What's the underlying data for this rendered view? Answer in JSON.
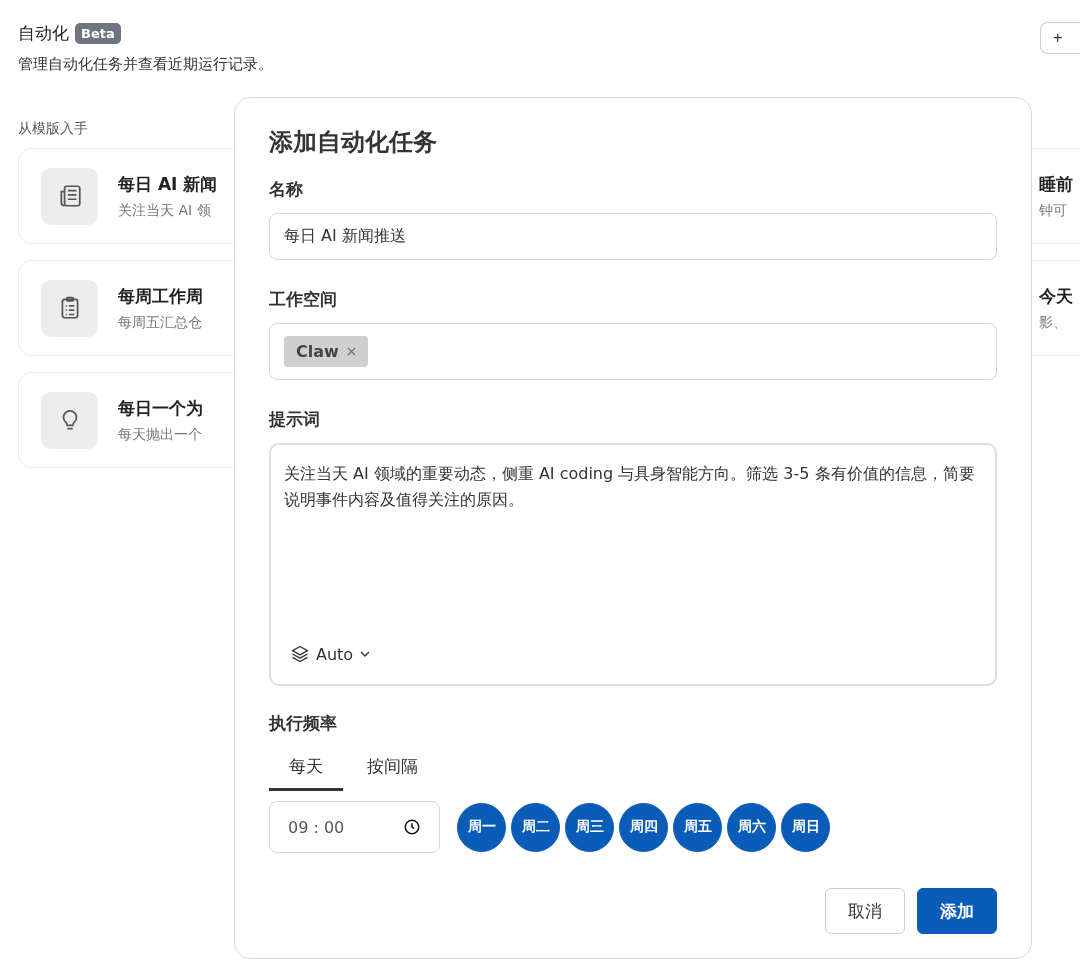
{
  "page": {
    "title": "自动化",
    "badge": "Beta",
    "subtitle": "管理自动化任务并查看近期运行记录。",
    "add_button": "+"
  },
  "templates": {
    "heading": "从模版入手",
    "left": [
      {
        "title": "每日 AI 新闻",
        "desc": "关注当天 AI 领"
      },
      {
        "title": "每周工作周",
        "desc": "每周五汇总仓"
      },
      {
        "title": "每日一个为",
        "desc": "每天抛出一个"
      }
    ],
    "right": [
      {
        "title": "睡前",
        "desc": "钟可"
      },
      {
        "title": "今天",
        "desc": "影、"
      }
    ]
  },
  "dialog": {
    "title": "添加自动化任务",
    "name": {
      "label": "名称",
      "value": "每日 AI 新闻推送"
    },
    "workspace": {
      "label": "工作空间",
      "tags": [
        "Claw"
      ]
    },
    "prompt": {
      "label": "提示词",
      "value": "关注当天 AI 领域的重要动态，侧重 AI coding 与具身智能方向。筛选 3-5 条有价值的信息，简要说明事件内容及值得关注的原因。",
      "model": "Auto"
    },
    "schedule": {
      "label": "执行频率",
      "tabs": [
        {
          "label": "每天",
          "selected": true
        },
        {
          "label": "按间隔",
          "selected": false
        }
      ],
      "time": "09 : 00",
      "days": [
        {
          "label": "周一",
          "selected": true
        },
        {
          "label": "周二",
          "selected": true
        },
        {
          "label": "周三",
          "selected": true
        },
        {
          "label": "周四",
          "selected": true
        },
        {
          "label": "周五",
          "selected": true
        },
        {
          "label": "周六",
          "selected": true
        },
        {
          "label": "周日",
          "selected": true
        }
      ]
    },
    "buttons": [
      {
        "label": "取消",
        "kind": "secondary"
      },
      {
        "label": "添加",
        "kind": "primary"
      }
    ]
  }
}
